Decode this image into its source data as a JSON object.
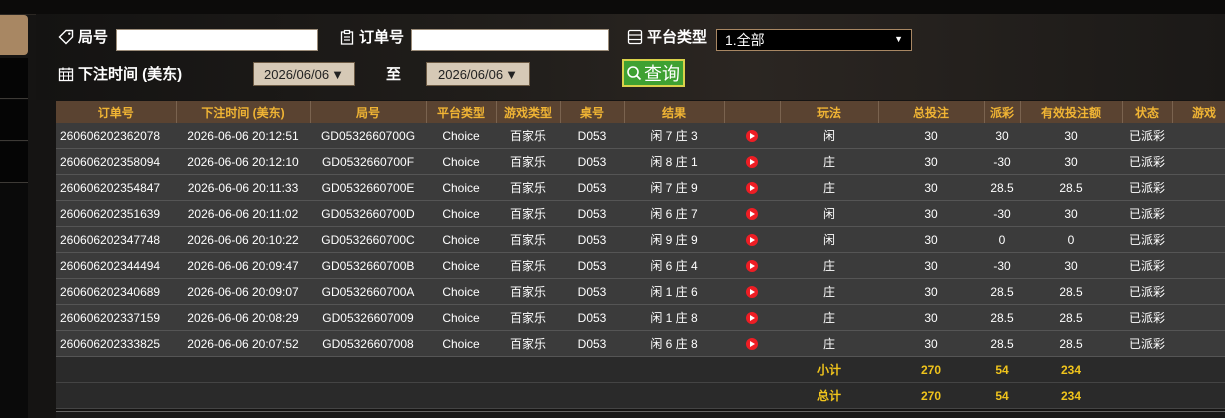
{
  "filters": {
    "round_label": "局号",
    "order_label": "订单号",
    "platform_label": "平台类型",
    "platform_selected": "1.全部",
    "time_label": "下注时间 (美东)",
    "date_from": "2026/06/06",
    "to_label": "至",
    "date_to": "2026/06/06",
    "query_label": "查询"
  },
  "table": {
    "headers": [
      "订单号",
      "下注时间 (美东)",
      "局号",
      "平台类型",
      "游戏类型",
      "桌号",
      "结果",
      "",
      "玩法",
      "总投注",
      "派彩",
      "有效投注额",
      "状态",
      "游戏"
    ],
    "rows": [
      {
        "order": "260606202362078",
        "time": "2026-06-06 20:12:51",
        "round": "GD0532660700G",
        "platform": "Choice",
        "game": "百家乐",
        "table": "D053",
        "result": "闲 7 庄 3",
        "play": "闲",
        "bet": "30",
        "payout": "30",
        "payout_tone": "red",
        "valid": "30",
        "status": "已派彩"
      },
      {
        "order": "260606202358094",
        "time": "2026-06-06 20:12:10",
        "round": "GD0532660700F",
        "platform": "Choice",
        "game": "百家乐",
        "table": "D053",
        "result": "闲 8 庄 1",
        "play": "庄",
        "bet": "30",
        "payout": "-30",
        "payout_tone": "neg",
        "valid": "30",
        "status": "已派彩"
      },
      {
        "order": "260606202354847",
        "time": "2026-06-06 20:11:33",
        "round": "GD0532660700E",
        "platform": "Choice",
        "game": "百家乐",
        "table": "D053",
        "result": "闲 7 庄 9",
        "play": "庄",
        "bet": "30",
        "payout": "28.5",
        "payout_tone": "red",
        "valid": "28.5",
        "status": "已派彩"
      },
      {
        "order": "260606202351639",
        "time": "2026-06-06 20:11:02",
        "round": "GD0532660700D",
        "platform": "Choice",
        "game": "百家乐",
        "table": "D053",
        "result": "闲 6 庄 7",
        "play": "闲",
        "bet": "30",
        "payout": "-30",
        "payout_tone": "neg",
        "valid": "30",
        "status": "已派彩"
      },
      {
        "order": "260606202347748",
        "time": "2026-06-06 20:10:22",
        "round": "GD0532660700C",
        "platform": "Choice",
        "game": "百家乐",
        "table": "D053",
        "result": "闲 9 庄 9",
        "play": "闲",
        "bet": "30",
        "payout": "0",
        "payout_tone": "plain",
        "valid": "0",
        "status": "已派彩"
      },
      {
        "order": "260606202344494",
        "time": "2026-06-06 20:09:47",
        "round": "GD0532660700B",
        "platform": "Choice",
        "game": "百家乐",
        "table": "D053",
        "result": "闲 6 庄 4",
        "play": "庄",
        "bet": "30",
        "payout": "-30",
        "payout_tone": "neg",
        "valid": "30",
        "status": "已派彩"
      },
      {
        "order": "260606202340689",
        "time": "2026-06-06 20:09:07",
        "round": "GD0532660700A",
        "platform": "Choice",
        "game": "百家乐",
        "table": "D053",
        "result": "闲 1 庄 6",
        "play": "庄",
        "bet": "30",
        "payout": "28.5",
        "payout_tone": "red",
        "valid": "28.5",
        "status": "已派彩"
      },
      {
        "order": "260606202337159",
        "time": "2026-06-06 20:08:29",
        "round": "GD05326607009",
        "platform": "Choice",
        "game": "百家乐",
        "table": "D053",
        "result": "闲 1 庄 8",
        "play": "庄",
        "bet": "30",
        "payout": "28.5",
        "payout_tone": "red",
        "valid": "28.5",
        "status": "已派彩"
      },
      {
        "order": "260606202333825",
        "time": "2026-06-06 20:07:52",
        "round": "GD05326607008",
        "platform": "Choice",
        "game": "百家乐",
        "table": "D053",
        "result": "闲 6 庄 8",
        "play": "庄",
        "bet": "30",
        "payout": "28.5",
        "payout_tone": "red",
        "valid": "28.5",
        "status": "已派彩"
      }
    ],
    "subtotal": {
      "label": "小计",
      "bet": "270",
      "payout": "54",
      "valid": "234"
    },
    "total": {
      "label": "总计",
      "bet": "270",
      "payout": "54",
      "valid": "234"
    }
  },
  "colors": {
    "header_bg": "#5a4331",
    "header_text": "#f0b434",
    "row_bg": "#3b3b3b",
    "negative": "#4ed12a",
    "positive_dim": "#b5171f",
    "status": "#2ad12a",
    "summary": "#f0c41c"
  }
}
